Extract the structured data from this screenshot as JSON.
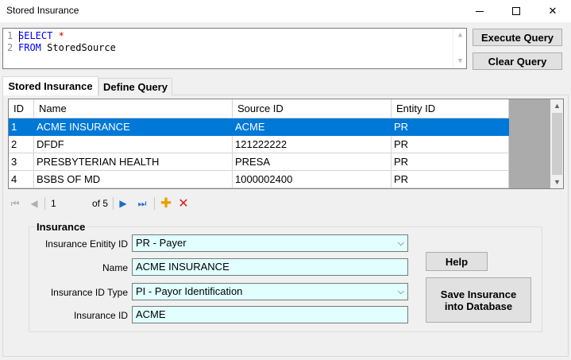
{
  "window": {
    "title": "Stored Insurance",
    "minimize_glyph": "—",
    "close_glyph": "✕"
  },
  "query_editor": {
    "line_numbers": [
      "1",
      "2"
    ],
    "line1_keyword": "SELECT",
    "line1_star": "*",
    "line2_keyword": "FROM",
    "line2_table": "StoredSource"
  },
  "buttons": {
    "execute_query": "Execute Query",
    "clear_query": "Clear Query",
    "help": "Help",
    "save_line1": "Save Insurance",
    "save_line2": "into Database"
  },
  "tabs": {
    "active": "Stored Insurance",
    "inactive": "Define Query"
  },
  "grid": {
    "columns": [
      "ID",
      "Name",
      "Source ID",
      "Entity ID"
    ],
    "rows": [
      [
        "1",
        "ACME INSURANCE",
        "ACME",
        "PR"
      ],
      [
        "2",
        "DFDF",
        "121222222",
        "PR"
      ],
      [
        "3",
        "PRESBYTERIAN HEALTH",
        "PRESA",
        "PR"
      ],
      [
        "4",
        "BSBS OF MD",
        "1000002400",
        "PR"
      ]
    ],
    "selected_row": 0
  },
  "navigator": {
    "position": "1",
    "of_text": "of 5",
    "first_glyph": "⏮",
    "prev_glyph": "◀",
    "next_glyph": "▶",
    "last_glyph": "⏭",
    "add_glyph": "✚",
    "delete_glyph": "✕"
  },
  "insurance_form": {
    "group_title": "Insurance",
    "entity_id_label": "Insurance Enitity ID",
    "entity_id_value": "PR - Payer",
    "name_label": "Name",
    "name_value": "ACME INSURANCE",
    "id_type_label": "Insurance ID Type",
    "id_type_value": "PI - Payor Identification",
    "insurance_id_label": "Insurance ID",
    "insurance_id_value": "ACME"
  },
  "colors": {
    "selection": "#0078d7",
    "field_background": "#e1ffff",
    "sql_keyword": "#0000ff",
    "sql_star": "#c00000"
  }
}
